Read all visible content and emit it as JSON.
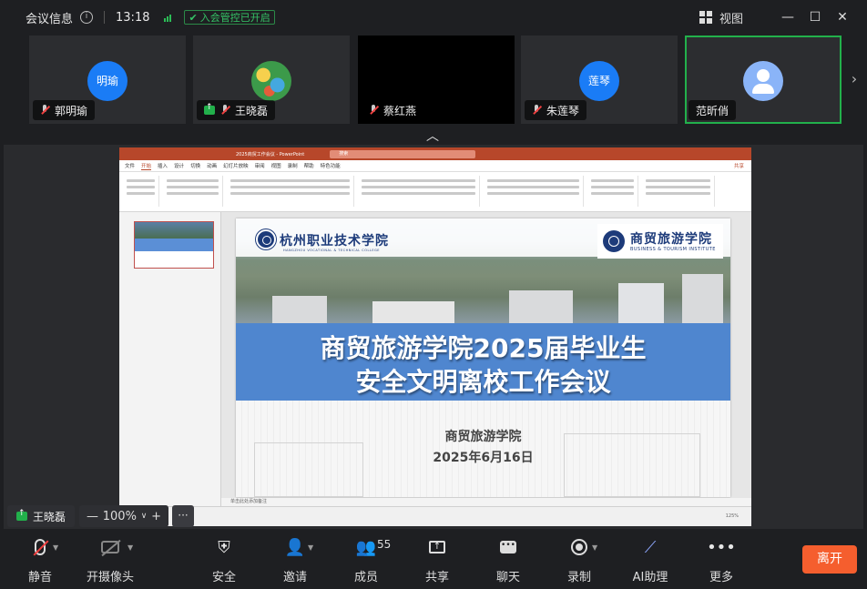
{
  "titlebar": {
    "meeting_info": "会议信息",
    "info_icon": "info-icon",
    "time": "13:18",
    "lock_status": "入会管控已开启",
    "view_label": "视图"
  },
  "participants": [
    {
      "name": "郭明瑜",
      "avatar_text": "明瑜",
      "muted": true
    },
    {
      "name": "王晓磊",
      "avatar_text": "",
      "muted": true,
      "sharing": true
    },
    {
      "name": "蔡红燕",
      "avatar_text": "",
      "muted": true
    },
    {
      "name": "朱莲琴",
      "avatar_text": "莲琴",
      "muted": true
    },
    {
      "name": "范昕俏",
      "avatar_text": "",
      "muted": false,
      "active": true
    }
  ],
  "ppt": {
    "doc_title": "2025商贸工作会议 - PowerPoint",
    "search_placeholder": "搜索",
    "menus": [
      "文件",
      "开始",
      "插入",
      "设计",
      "切换",
      "动画",
      "幻灯片放映",
      "审阅",
      "视图",
      "录制",
      "帮助",
      "特色功能"
    ],
    "share_label": "共享",
    "notes_hint": "单击此处添加备注",
    "zoom_level": "125%"
  },
  "slide": {
    "school_cn": "杭州职业技术学院",
    "school_en": "HANGZHOU VOCATIONAL & TECHNICAL COLLEGE",
    "institute_cn": "商贸旅游学院",
    "institute_en": "BUSINESS & TOURISM INSTITUTE",
    "title_line1": "商贸旅游学院2025届毕业生",
    "title_line2": "安全文明离校工作会议",
    "org": "商贸旅游学院",
    "date": "2025年6月16日"
  },
  "overlay": {
    "presenter": "王晓磊",
    "zoom": "100%"
  },
  "toolbar": {
    "mute": "静音",
    "camera": "开摄像头",
    "security": "安全",
    "invite": "邀请",
    "members": "成员",
    "members_count": "55",
    "share": "共享",
    "chat": "聊天",
    "record": "录制",
    "ai": "AI助理",
    "more": "更多",
    "leave": "离开"
  },
  "colors": {
    "brand_green": "#22b04b",
    "leave_orange": "#f55e2e",
    "avatar_blue": "#1a7cf6",
    "ppt_red": "#b7472a",
    "slide_band_blue": "#4f86cf"
  }
}
